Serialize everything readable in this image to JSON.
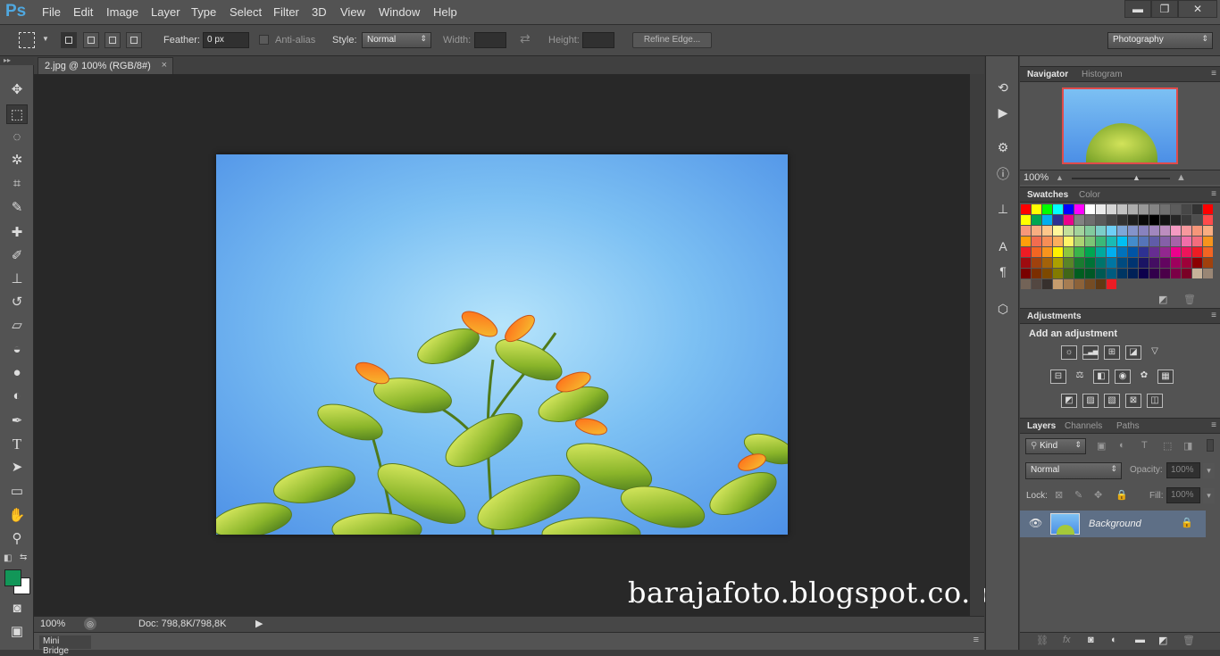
{
  "app": {
    "logo": "Ps",
    "menus": [
      "File",
      "Edit",
      "Image",
      "Layer",
      "Type",
      "Select",
      "Filter",
      "3D",
      "View",
      "Window",
      "Help"
    ],
    "window_buttons": [
      "▬",
      "❐",
      "✕"
    ]
  },
  "options": {
    "feather_label": "Feather:",
    "feather_value": "0 px",
    "antialias_label": "Anti-alias",
    "style_label": "Style:",
    "style_value": "Normal",
    "width_label": "Width:",
    "height_label": "Height:",
    "refine_edge": "Refine Edge...",
    "workspace": "Photography"
  },
  "document": {
    "tab_title": "2.jpg @ 100% (RGB/8#)",
    "close": "×",
    "watermark": "barajafoto.blogspot.co.id"
  },
  "status": {
    "zoom": "100%",
    "doc_info": "Doc: 798,8K/798,8K"
  },
  "mini_bridge": {
    "label": "Mini Bridge"
  },
  "navigator": {
    "tabs": [
      "Navigator",
      "Histogram"
    ],
    "zoom": "100%"
  },
  "swatches": {
    "tabs": [
      "Swatches",
      "Color"
    ],
    "colors": [
      "#ff0000",
      "#ffff00",
      "#00ff00",
      "#00ffff",
      "#0000ff",
      "#ff00ff",
      "#ffffff",
      "#ebebeb",
      "#d6d6d6",
      "#c2c2c2",
      "#adadad",
      "#999999",
      "#858585",
      "#707070",
      "#5c5c5c",
      "#474747",
      "#333333",
      "#ff0000",
      "#ffff00",
      "#00a651",
      "#00aeef",
      "#2e3192",
      "#ec008c",
      "#828282",
      "#6e6e6e",
      "#5a5a5a",
      "#464646",
      "#323232",
      "#1e1e1e",
      "#0a0a0a",
      "#000000",
      "#121212",
      "#262626",
      "#3a3a3a",
      "#4e4e4e",
      "#ff4b4b",
      "#f7977a",
      "#f9ad81",
      "#fdc68a",
      "#fff79a",
      "#c4df9b",
      "#a3d39c",
      "#82ca9d",
      "#7bcdc8",
      "#6ecff6",
      "#7ea7d8",
      "#8493ca",
      "#8882be",
      "#a187be",
      "#bc8dbf",
      "#f49ac2",
      "#f6989d",
      "#f69679",
      "#f9ad81",
      "#ff9e0b",
      "#f26c4f",
      "#f68e56",
      "#fbaf5d",
      "#fff468",
      "#acd372",
      "#7cc576",
      "#3bb878",
      "#1abbb4",
      "#00bff3",
      "#438ccb",
      "#5574b9",
      "#605ca8",
      "#855fa8",
      "#a763a8",
      "#f06ea9",
      "#f26d7d",
      "#f7941d",
      "#ed1c24",
      "#f26522",
      "#f7941d",
      "#fff200",
      "#8dc63f",
      "#39b54a",
      "#00a651",
      "#00a99d",
      "#00aeef",
      "#0072bc",
      "#0054a6",
      "#2e3192",
      "#662d91",
      "#92278f",
      "#ec008c",
      "#ed145b",
      "#ed1c24",
      "#f26522",
      "#9e0b0f",
      "#a0410d",
      "#a36209",
      "#aba000",
      "#598527",
      "#197b30",
      "#007236",
      "#00746b",
      "#0076a3",
      "#004b80",
      "#003471",
      "#1b1464",
      "#440e62",
      "#630460",
      "#9e005d",
      "#9e0039",
      "#8b0000",
      "#a0410d",
      "#790000",
      "#7b2e00",
      "#7d4900",
      "#827b00",
      "#406618",
      "#005e20",
      "#005826",
      "#005952",
      "#005b7f",
      "#003663",
      "#002157",
      "#0d004c",
      "#32004b",
      "#4b0049",
      "#7b0046",
      "#7a0026",
      "#c7b299",
      "#998675",
      "#736357",
      "#534741",
      "#37302d",
      "#c69c6d",
      "#a67c52",
      "#8c6239",
      "#754c24",
      "#603913",
      "#ed1c24"
    ]
  },
  "adjustments": {
    "title": "Adjustments",
    "subtitle": "Add an adjustment",
    "icons": [
      "☼",
      "▁▃▅",
      "⊞",
      "◪",
      "▽",
      "⊟",
      "⚖",
      "◧",
      "◉",
      "✿",
      "▦",
      "◩",
      "▨",
      "▧",
      "⊠",
      "◫"
    ]
  },
  "layers": {
    "tabs": [
      "Layers",
      "Channels",
      "Paths"
    ],
    "kind": "Kind",
    "blend": "Normal",
    "opacity_label": "Opacity:",
    "opacity": "100%",
    "lock_label": "Lock:",
    "fill_label": "Fill:",
    "fill": "100%",
    "layer_name": "Background"
  },
  "colors": {
    "foreground": "#129658",
    "background": "#ffffff",
    "accent": "#4fa8e0"
  }
}
